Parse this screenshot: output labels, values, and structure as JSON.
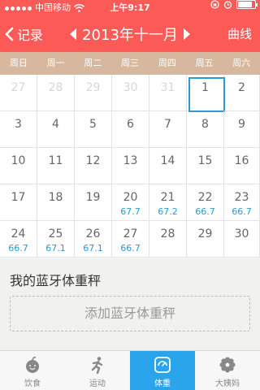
{
  "status_bar": {
    "carrier": "中国移动",
    "time": "上午9:17",
    "battery_level": 0.85
  },
  "nav": {
    "back_label": "记录",
    "title": "2013年十一月",
    "right_label": "曲线"
  },
  "weekdays": [
    "周日",
    "周一",
    "周二",
    "周三",
    "周四",
    "周五",
    "周六"
  ],
  "calendar": {
    "weeks": [
      [
        {
          "day": "27",
          "faded": true
        },
        {
          "day": "28",
          "faded": true
        },
        {
          "day": "29",
          "faded": true
        },
        {
          "day": "30",
          "faded": true
        },
        {
          "day": "31",
          "faded": true
        },
        {
          "day": "1",
          "today": true
        },
        {
          "day": "2"
        }
      ],
      [
        {
          "day": "3"
        },
        {
          "day": "4"
        },
        {
          "day": "5"
        },
        {
          "day": "6"
        },
        {
          "day": "7"
        },
        {
          "day": "8"
        },
        {
          "day": "9"
        }
      ],
      [
        {
          "day": "10"
        },
        {
          "day": "11"
        },
        {
          "day": "12"
        },
        {
          "day": "13"
        },
        {
          "day": "14"
        },
        {
          "day": "15"
        },
        {
          "day": "16"
        }
      ],
      [
        {
          "day": "17"
        },
        {
          "day": "18"
        },
        {
          "day": "19"
        },
        {
          "day": "20",
          "weight": "67.7"
        },
        {
          "day": "21",
          "weight": "67.2"
        },
        {
          "day": "22",
          "weight": "66.7"
        },
        {
          "day": "23",
          "weight": "66.7"
        }
      ],
      [
        {
          "day": "24",
          "weight": "66.7"
        },
        {
          "day": "25",
          "weight": "67.1"
        },
        {
          "day": "26",
          "weight": "67.1"
        },
        {
          "day": "27",
          "weight": "66.7"
        },
        {
          "day": "28"
        },
        {
          "day": "29"
        },
        {
          "day": "30"
        }
      ]
    ]
  },
  "scale": {
    "title": "我的蓝牙体重秤",
    "add_label": "添加蓝牙体重秤"
  },
  "tabs": [
    {
      "label": "饮食",
      "icon": "apple-icon"
    },
    {
      "label": "运动",
      "icon": "runner-icon"
    },
    {
      "label": "体重",
      "icon": "scale-icon",
      "active": true
    },
    {
      "label": "大姨妈",
      "icon": "gear-flower-icon"
    }
  ],
  "colors": {
    "header": "#fc5a57",
    "weekday_bar": "#d7b89e",
    "accent": "#2a9ad4",
    "active_tab": "#2aa5ec"
  }
}
